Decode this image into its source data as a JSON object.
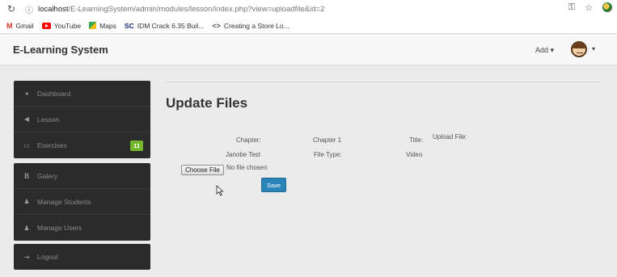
{
  "browser": {
    "url_host": "localhost",
    "url_path": "/E-LearningSystem/admin/modules/lesson/index.php?view=uploadfile&id=2",
    "icons": [
      "reload-icon",
      "info-icon",
      "key-icon",
      "star-icon",
      "extension-icon"
    ],
    "bookmarks": [
      {
        "label": "Gmail",
        "icon": "gmail-icon"
      },
      {
        "label": "YouTube",
        "icon": "youtube-icon"
      },
      {
        "label": "Maps",
        "icon": "maps-icon"
      },
      {
        "label": "IDM Crack 6.35 Buil...",
        "icon": "sc-icon",
        "prefix": "SC"
      },
      {
        "label": "Creating a Store Lo...",
        "icon": "code-icon",
        "prefix": "<>"
      }
    ]
  },
  "header": {
    "brand": "E-Learning System",
    "add_label": "Add",
    "caret": "▾"
  },
  "sidebar": {
    "groups": [
      [
        {
          "label": "Dashboard",
          "icon": "dashboard-icon"
        },
        {
          "label": "Lesson",
          "icon": "megaphone-icon"
        },
        {
          "label": "Exercises",
          "icon": "inbox-icon",
          "badge": "11"
        }
      ],
      [
        {
          "label": "Galery",
          "icon": "bold-b-icon"
        },
        {
          "label": "Manage Students",
          "icon": "user-icon"
        },
        {
          "label": "Manage Users",
          "icon": "user-icon"
        }
      ],
      [
        {
          "label": "Logout",
          "icon": "logout-icon"
        }
      ]
    ]
  },
  "main": {
    "title": "Update Files",
    "chapter_label": "Chapter:",
    "chapter_value": "Chapter 1",
    "title_label": "Title:",
    "title_value": "Janobe Test",
    "filetype_label": "File Type:",
    "filetype_value": "Video",
    "upload_label": "Upload File:",
    "choose_button": "Choose File",
    "no_file": "No file chosen",
    "save_button": "Save"
  },
  "colors": {
    "sidebar_bg": "#2b2b2b",
    "badge": "#74b72e",
    "save_button": "#2a84b7",
    "page_bg": "#ebebeb"
  }
}
